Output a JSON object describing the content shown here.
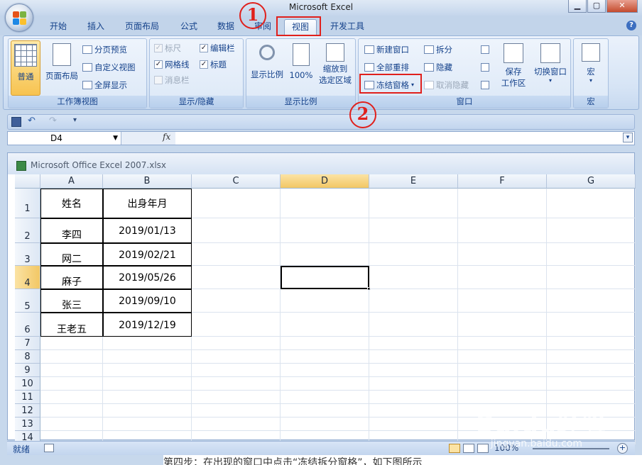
{
  "window": {
    "title": "Microsoft Excel",
    "min": "▁",
    "max": "▢",
    "close": "✕"
  },
  "tabs": [
    {
      "label": "开始"
    },
    {
      "label": "插入"
    },
    {
      "label": "页面布局"
    },
    {
      "label": "公式"
    },
    {
      "label": "数据"
    },
    {
      "label": "审阅"
    },
    {
      "label": "视图"
    },
    {
      "label": "开发工具"
    }
  ],
  "ribbon": {
    "workbook_views": {
      "label": "工作簿视图",
      "normal": "普通",
      "page_layout": "页面布局",
      "page_break": "分页预览",
      "custom_views": "自定义视图",
      "full_screen": "全屏显示"
    },
    "show_hide": {
      "label": "显示/隐藏",
      "ruler": "标尺",
      "formula_bar": "编辑栏",
      "gridlines": "网格线",
      "headings": "标题",
      "message_bar": "消息栏"
    },
    "zoom": {
      "label": "显示比例",
      "zoom": "显示比例",
      "hundred": "100%",
      "zoom_selection_1": "缩放到",
      "zoom_selection_2": "选定区域"
    },
    "window": {
      "label": "窗口",
      "new_window": "新建窗口",
      "arrange_all": "全部重排",
      "freeze_panes": "冻结窗格",
      "split": "拆分",
      "hide": "隐藏",
      "unhide": "取消隐藏",
      "save_workspace_1": "保存",
      "save_workspace_2": "工作区",
      "switch_windows": "切换窗口"
    },
    "macros": {
      "label": "宏",
      "macros": "宏"
    }
  },
  "formula_bar": {
    "name_box": "D4",
    "fx": "fx",
    "value": ""
  },
  "workbook": {
    "title": "Microsoft Office Excel 2007.xlsx"
  },
  "columns": [
    "A",
    "B",
    "C",
    "D",
    "E",
    "F",
    "G"
  ],
  "rows": [
    "1",
    "2",
    "3",
    "4",
    "5",
    "6",
    "7",
    "8",
    "9",
    "10",
    "11",
    "12",
    "13",
    "14"
  ],
  "table": {
    "header": [
      "姓名",
      "出身年月"
    ],
    "data": [
      [
        "李四",
        "2019/01/13"
      ],
      [
        "网二",
        "2019/02/21"
      ],
      [
        "麻子",
        "2019/05/26"
      ],
      [
        "张三",
        "2019/09/10"
      ],
      [
        "王老五",
        "2019/12/19"
      ]
    ]
  },
  "status": {
    "ready": "就绪",
    "zoom": "100%"
  },
  "annotations": {
    "step1": "1",
    "step2": "2"
  },
  "watermark": {
    "brand": "Baidu经验",
    "url": "jingyan.baidu.com"
  },
  "bottom_text": "第四步：在出现的窗口中点击“冻结拆分窗格”，如下图所示"
}
